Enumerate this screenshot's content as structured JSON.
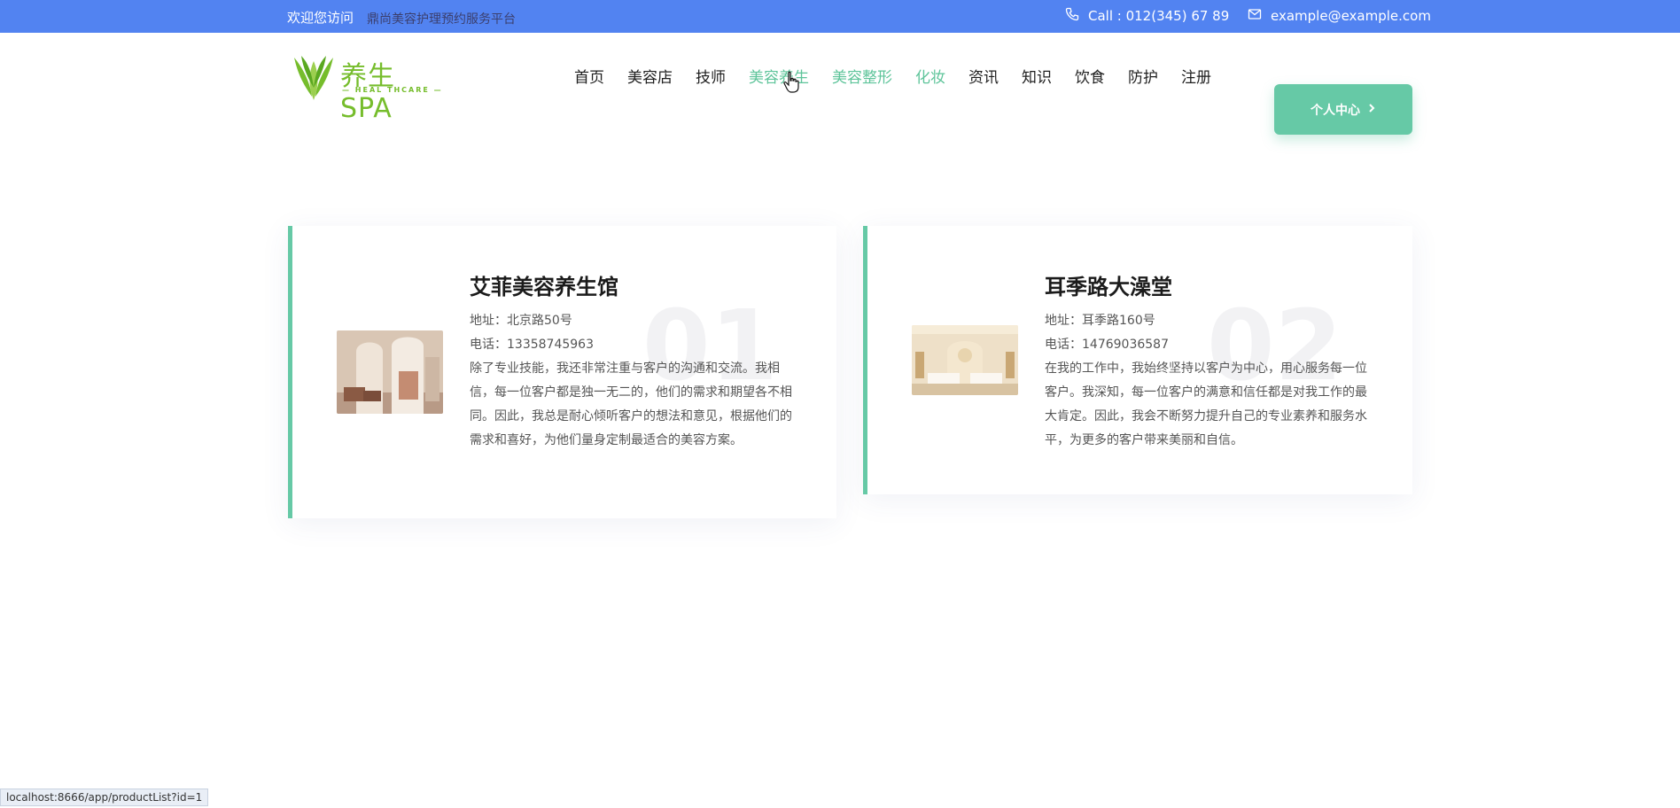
{
  "topbar": {
    "welcome": "欢迎您访问",
    "subtitle": "鼎尚美容护理预约服务平台",
    "phone": "Call : 012(345) 67 89",
    "email": "example@example.com"
  },
  "header": {
    "logo_text": "养生SPA",
    "logo_sub": "— HEAL THCARE —",
    "nav": [
      "首页",
      "美容店",
      "技师",
      "美容养生",
      "美容整形",
      "化妆",
      "资讯",
      "知识",
      "饮食",
      "防护",
      "注册"
    ],
    "active_nav": [
      "美容养生",
      "美容整形",
      "化妆"
    ],
    "center_button": "个人中心"
  },
  "cards": [
    {
      "number": "01",
      "name": "艾菲美容养生馆",
      "address": "地址：北京路50号",
      "phone": "电话：13358745963",
      "desc": "除了专业技能，我还非常注重与客户的沟通和交流。我相信，每一位客户都是独一无二的，他们的需求和期望各不相同。因此，我总是耐心倾听客户的想法和意见，根据他们的需求和喜好，为他们量身定制最适合的美容方案。"
    },
    {
      "number": "02",
      "name": "耳季路大澡堂",
      "address": "地址：耳季路160号",
      "phone": "电话：14769036587",
      "desc": "在我的工作中，我始终坚持以客户为中心，用心服务每一位客户。我深知，每一位客户的满意和信任都是对我工作的最大肯定。因此，我会不断努力提升自己的专业素养和服务水平，为更多的客户带来美丽和自信。"
    }
  ],
  "statusbar": {
    "url": "localhost:8666/app/productList?id=1"
  },
  "colors": {
    "topbar": "#5283f1",
    "accent": "#66c9a6",
    "logo": "#76bd2c"
  }
}
